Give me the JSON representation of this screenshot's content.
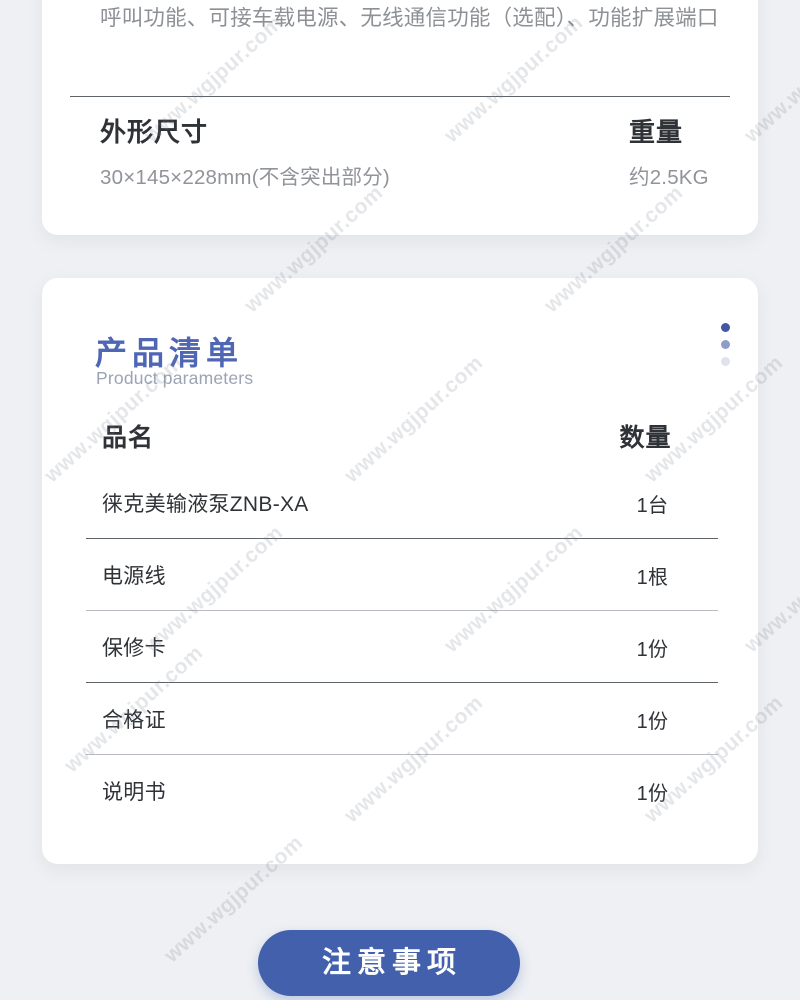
{
  "specs_card": {
    "feature_text": "呼叫功能、可接车载电源、无线通信功能（选配）、功能扩展端口",
    "dimensions": {
      "label": "外形尺寸",
      "value": "30×145×228mm(不含突出部分)"
    },
    "weight": {
      "label": "重量",
      "value": "约2.5KG"
    }
  },
  "product_list_card": {
    "title": "产品清单",
    "subtitle": "Product parameters",
    "columns": {
      "name": "品名",
      "quantity": "数量"
    },
    "rows": [
      {
        "name": "徕克美输液泵ZNB-XA",
        "quantity": "1台"
      },
      {
        "name": "电源线",
        "quantity": "1根"
      },
      {
        "name": "保修卡",
        "quantity": "1份"
      },
      {
        "name": "合格证",
        "quantity": "1份"
      },
      {
        "name": "说明书",
        "quantity": "1份"
      }
    ]
  },
  "notice_button": {
    "label": "注意事项"
  },
  "watermark": {
    "text": "www.wgjpur.com"
  },
  "colors": {
    "page_background": "#eef0f3",
    "card_background": "#ffffff",
    "title_blue": "#4e66b4",
    "button_blue": "#4260ab",
    "body_text": "#2f3236",
    "muted_text": "#8d9196",
    "subtitle_text": "#9ba3b4",
    "divider": "#5f6469"
  }
}
